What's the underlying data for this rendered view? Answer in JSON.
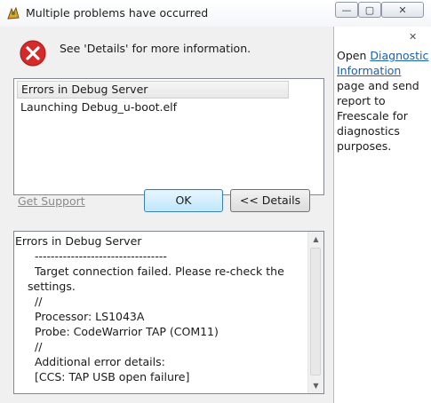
{
  "window": {
    "title": "Multiple problems have occurred",
    "minimize_glyph": "—",
    "maximize_glyph": "▢",
    "close_glyph": "✕"
  },
  "main": {
    "message": "See 'Details' for more information.",
    "problems": [
      "Errors in Debug Server",
      "Launching Debug_u-boot.elf"
    ],
    "support_link": "Get Support",
    "ok_button": "OK",
    "details_button": "<< Details",
    "details_lines": [
      "Errors in Debug Server",
      "---------------------------------",
      "Target connection failed. Please re-check the",
      "settings.",
      "//",
      "Processor: LS1043A",
      "Probe: CodeWarrior TAP (COM11)",
      "//",
      "Additional error details:",
      "[CCS: TAP USB open failure]"
    ],
    "scroll_up_glyph": "▲",
    "scroll_down_glyph": "▼"
  },
  "side_panel": {
    "close_glyph": "✕",
    "text_before": "Open ",
    "link_text": "Diagnostic Information",
    "text_after": " page and send report to Freescale for diagnostics purposes."
  },
  "colors": {
    "error_red": "#d42a2a",
    "link_blue": "#1a5fb4",
    "ok_border": "#3c7fb1"
  },
  "icons": [
    "app-icon",
    "error-icon",
    "close-icon",
    "scroll-up-icon",
    "scroll-down-icon"
  ]
}
